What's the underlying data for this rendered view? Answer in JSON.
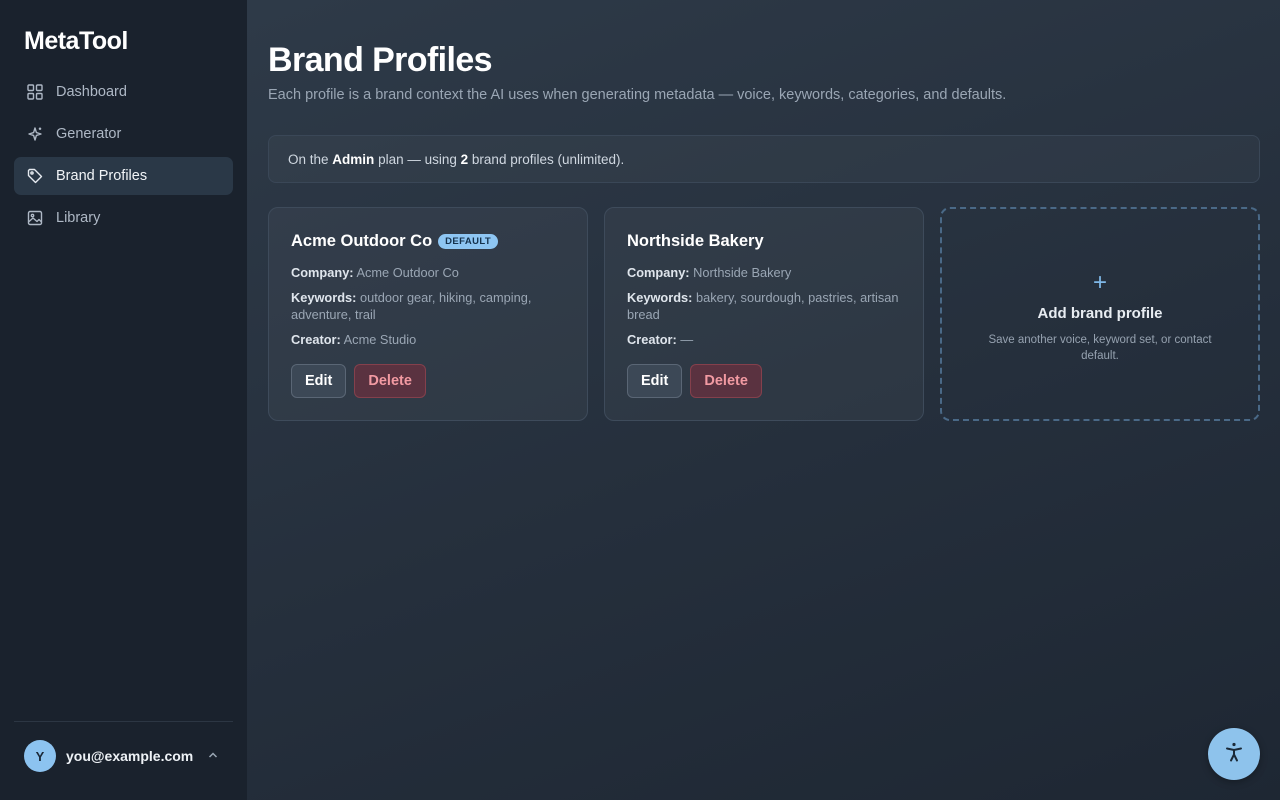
{
  "app": {
    "name": "MetaTool"
  },
  "sidebar": {
    "items": [
      {
        "label": "Dashboard",
        "icon": "grid-icon",
        "active": false
      },
      {
        "label": "Generator",
        "icon": "sparkle-icon",
        "active": false
      },
      {
        "label": "Brand Profiles",
        "icon": "tag-icon",
        "active": true
      },
      {
        "label": "Library",
        "icon": "image-icon",
        "active": false
      }
    ],
    "user": {
      "initial": "Y",
      "email": "you@example.com",
      "icon": "chevron-up-icon"
    }
  },
  "page": {
    "title": "Brand Profiles",
    "subtitle": "Each profile is a brand context the AI uses when generating metadata — voice, keywords, categories, and defaults."
  },
  "plan_banner": {
    "prefix": "On the",
    "plan": "Admin",
    "middle": "plan — using",
    "count": "2",
    "suffix": "brand profiles (unlimited)."
  },
  "profiles": [
    {
      "name": "Acme Outdoor Co",
      "badge": "DEFAULT",
      "company_label": "Company:",
      "company": "Acme Outdoor Co",
      "keywords_label": "Keywords:",
      "keywords": "outdoor gear, hiking, camping, adventure, trail",
      "creator_label": "Creator:",
      "creator": "Acme Studio",
      "edit_label": "Edit",
      "delete_label": "Delete"
    },
    {
      "name": "Northside Bakery",
      "badge": "",
      "company_label": "Company:",
      "company": "Northside Bakery",
      "keywords_label": "Keywords:",
      "keywords": "bakery, sourdough, pastries, artisan bread",
      "creator_label": "Creator:",
      "creator": "—",
      "edit_label": "Edit",
      "delete_label": "Delete"
    }
  ],
  "add_card": {
    "icon": "plus-icon",
    "plus": "+",
    "title": "Add brand profile",
    "description": "Save another voice, keyword set, or contact default."
  },
  "accessibility": {
    "icon": "accessibility-icon"
  },
  "colors": {
    "accent": "#8ec6f3",
    "danger": "#f29aa2",
    "sidebar_bg": "#1a222d",
    "active_nav_bg": "#2a3847"
  }
}
